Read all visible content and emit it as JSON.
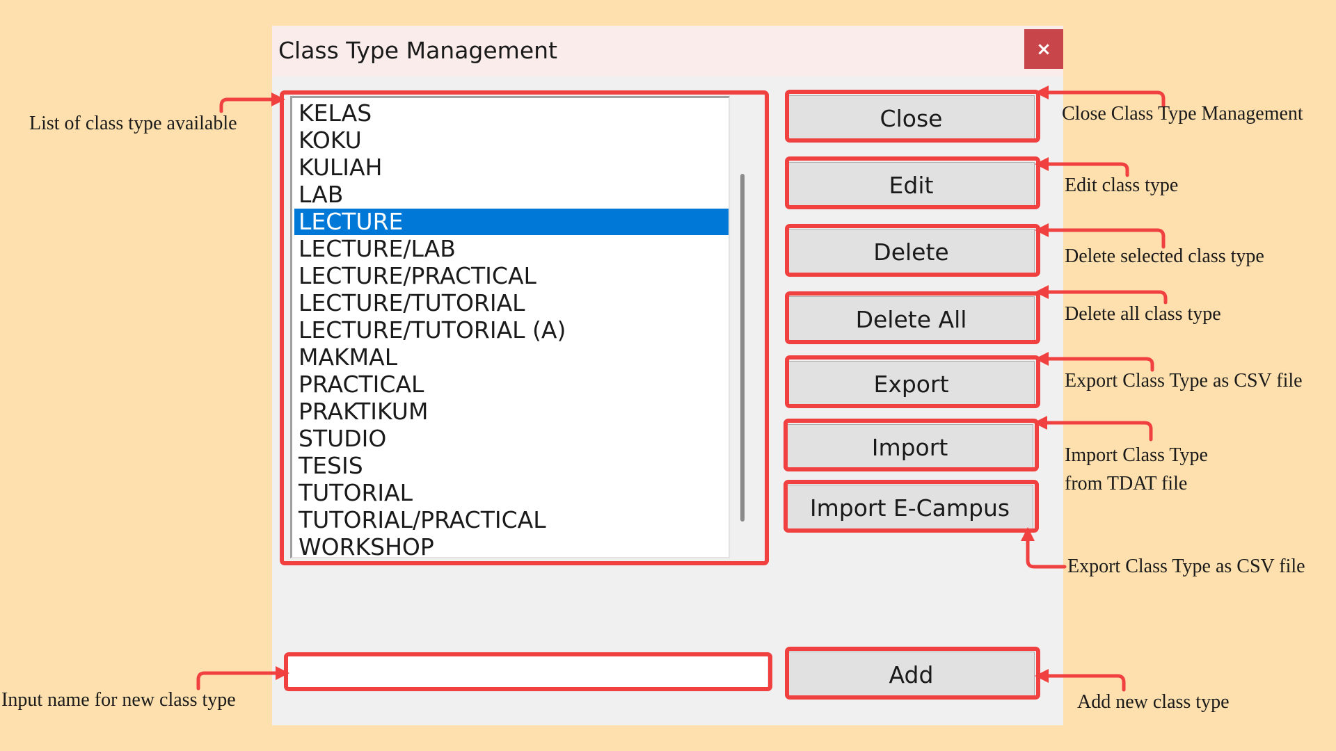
{
  "window": {
    "title": "Class Type Management",
    "close_glyph": "×"
  },
  "class_list": {
    "items": [
      "KELAS",
      "KOKU",
      "KULIAH",
      "LAB",
      "LECTURE",
      "LECTURE/LAB",
      "LECTURE/PRACTICAL",
      "LECTURE/TUTORIAL",
      "LECTURE/TUTORIAL (A)",
      "MAKMAL",
      "PRACTICAL",
      "PRAKTIKUM",
      "STUDIO",
      "TESIS",
      "TUTORIAL",
      "TUTORIAL/PRACTICAL",
      "WORKSHOP"
    ],
    "selected": "LECTURE"
  },
  "buttons": {
    "close": "Close",
    "edit": "Edit",
    "delete": "Delete",
    "delete_all": "Delete All",
    "export": "Export",
    "import": "Import",
    "import_ecampus": "Import E-Campus",
    "add": "Add"
  },
  "new_class_input": {
    "value": "",
    "placeholder": ""
  },
  "annotations": {
    "list": "List of class type available",
    "input": "Input name for new class type",
    "close": "Close Class Type Management",
    "edit": "Edit class type",
    "delete": "Delete selected class type",
    "delete_all": "Delete all class type",
    "export": "Export Class Type as CSV file",
    "import_line1": "Import Class Type",
    "import_line2": "from TDAT file",
    "import_ecampus": "Export Class Type as CSV file",
    "add": "Add new class type"
  },
  "colors": {
    "page_background": "#fde0ad",
    "highlight_red": "#f0403f",
    "selection_blue": "#0078d7",
    "titlebar_close_red": "#c8454a"
  }
}
